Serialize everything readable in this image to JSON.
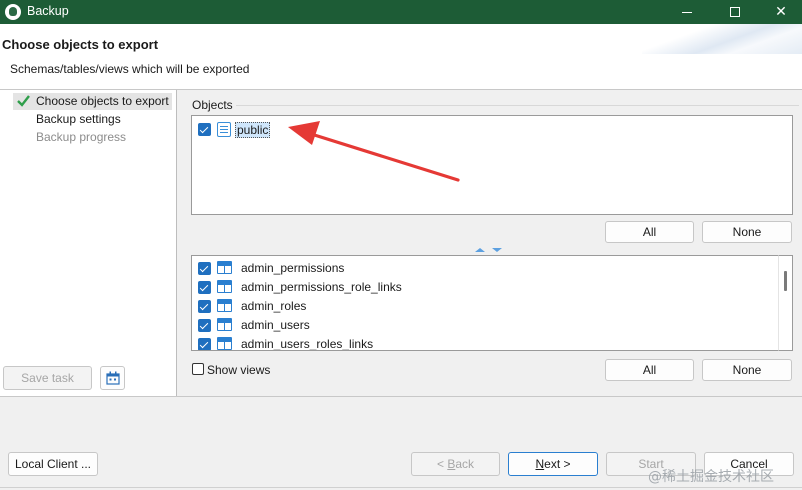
{
  "window": {
    "title": "Backup"
  },
  "header": {
    "title": "Choose objects to export",
    "subtitle": "Schemas/tables/views which will be exported"
  },
  "sidebar": {
    "steps": [
      {
        "label": "Choose objects to export",
        "state": "active"
      },
      {
        "label": "Backup settings",
        "state": "enabled"
      },
      {
        "label": "Backup progress",
        "state": "disabled"
      }
    ],
    "save_task_label": "Save task"
  },
  "objects": {
    "group_label": "Objects",
    "schemas": [
      {
        "name": "public",
        "checked": true
      }
    ],
    "all_label": "All",
    "none_label": "None"
  },
  "tables": {
    "items": [
      {
        "name": "admin_permissions",
        "checked": true
      },
      {
        "name": "admin_permissions_role_links",
        "checked": true
      },
      {
        "name": "admin_roles",
        "checked": true
      },
      {
        "name": "admin_users",
        "checked": true
      },
      {
        "name": "admin_users_roles_links",
        "checked": true
      }
    ],
    "show_views_label": "Show views",
    "show_views_checked": false,
    "all_label": "All",
    "none_label": "None"
  },
  "footer": {
    "local_client_label": "Local Client ...",
    "back_prefix": "< ",
    "back_key": "B",
    "back_rest": "ack",
    "next_key": "N",
    "next_rest": "ext >",
    "start_label": "Start",
    "cancel_label": "Cancel"
  },
  "watermark": "@稀土掘金技术社区",
  "colors": {
    "titlebar": "#1d5c36",
    "accent": "#1f6fbf",
    "arrow": "#e53935"
  }
}
